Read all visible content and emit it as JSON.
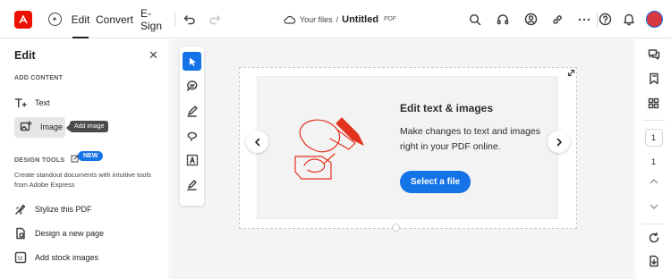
{
  "header": {
    "nav": [
      "Edit",
      "Convert",
      "E-Sign"
    ],
    "breadcrumb": {
      "folder": "Your files",
      "separator": "/",
      "file": "Untitled",
      "type": "PDF"
    },
    "icons": [
      "search-icon",
      "headset-icon",
      "share-user-icon",
      "link-icon",
      "more-icon",
      "help-icon",
      "bell-icon"
    ]
  },
  "panel": {
    "title": "Edit",
    "add_content_heading": "ADD CONTENT",
    "text_label": "Text",
    "image_label": "Image",
    "tooltip": "Add image",
    "design_heading": "DESIGN TOOLS",
    "new_badge": "NEW",
    "description": "Create standout documents with intuitive tools from Adobe Express",
    "items": [
      "Stylize this PDF",
      "Design a new page",
      "Add stock images"
    ]
  },
  "card": {
    "title": "Edit text & images",
    "text": "Make changes to text and images right in your PDF online.",
    "button": "Select a file"
  },
  "rail": {
    "page_box": "1",
    "page_number": "1"
  },
  "colors": {
    "accent": "#1473e6",
    "brand": "#eb1000"
  }
}
